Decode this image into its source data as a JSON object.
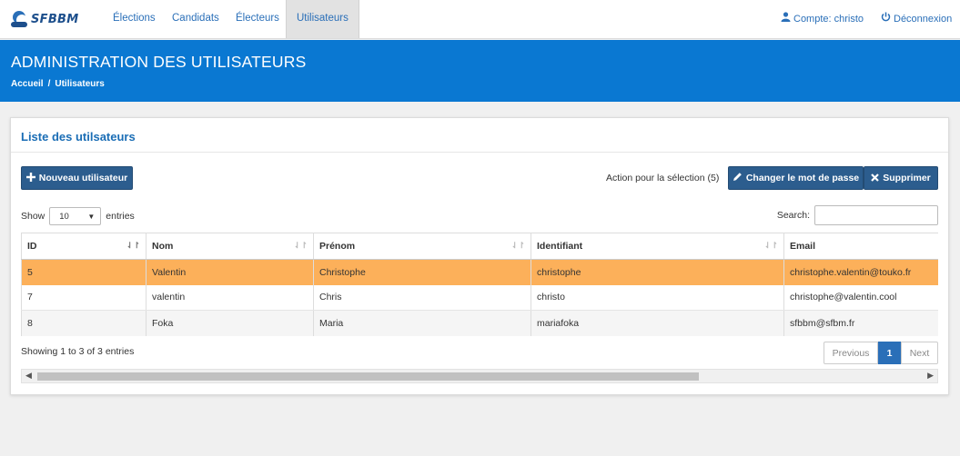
{
  "brand": {
    "logo_text": "SFBBM"
  },
  "nav": {
    "items": [
      "Élections",
      "Candidats",
      "Électeurs",
      "Utilisateurs"
    ],
    "active": "Utilisateurs",
    "account": "Compte: christo",
    "logout": "Déconnexion"
  },
  "header": {
    "title": "ADMINISTRATION DES UTILISATEURS",
    "breadcrumb": [
      "Accueil",
      "Utilisateurs"
    ],
    "breadcrumb_sep": "/"
  },
  "panel": {
    "title": "Liste des utilsateurs",
    "new_user_label": "Nouveau utilisateur",
    "selection_action_label": "Action pour la sélection (5)",
    "change_password_label": "Changer le mot de passe",
    "delete_label": "Supprimer"
  },
  "table_controls": {
    "show_label": "Show",
    "entries_label": "entries",
    "page_size": "10",
    "search_label": "Search:",
    "search_value": ""
  },
  "table": {
    "columns": [
      "ID",
      "Nom",
      "Prénom",
      "Identifiant",
      "Email"
    ],
    "rows": [
      {
        "id": "5",
        "nom": "Valentin",
        "prenom": "Christophe",
        "identifiant": "christophe",
        "email": "christophe.valentin@touko.fr",
        "selected": true
      },
      {
        "id": "7",
        "nom": "valentin",
        "prenom": "Chris",
        "identifiant": "christo",
        "email": "christophe@valentin.cool",
        "selected": false
      },
      {
        "id": "8",
        "nom": "Foka",
        "prenom": "Maria",
        "identifiant": "mariafoka",
        "email": "sfbbm@sfbm.fr",
        "selected": false
      }
    ]
  },
  "footer": {
    "info": "Showing 1 to 3 of 3 entries",
    "previous": "Previous",
    "page": "1",
    "next": "Next"
  },
  "colors": {
    "header_blue": "#0a78d2",
    "button_blue": "#2c5d8e",
    "selected_row": "#fcb05a",
    "link_blue": "#2a6fb8"
  },
  "icons": {
    "user": "user-icon",
    "power": "power-icon",
    "plus": "plus-icon",
    "pencil": "pencil-icon",
    "times": "times-icon",
    "sort": "sort-icon"
  }
}
